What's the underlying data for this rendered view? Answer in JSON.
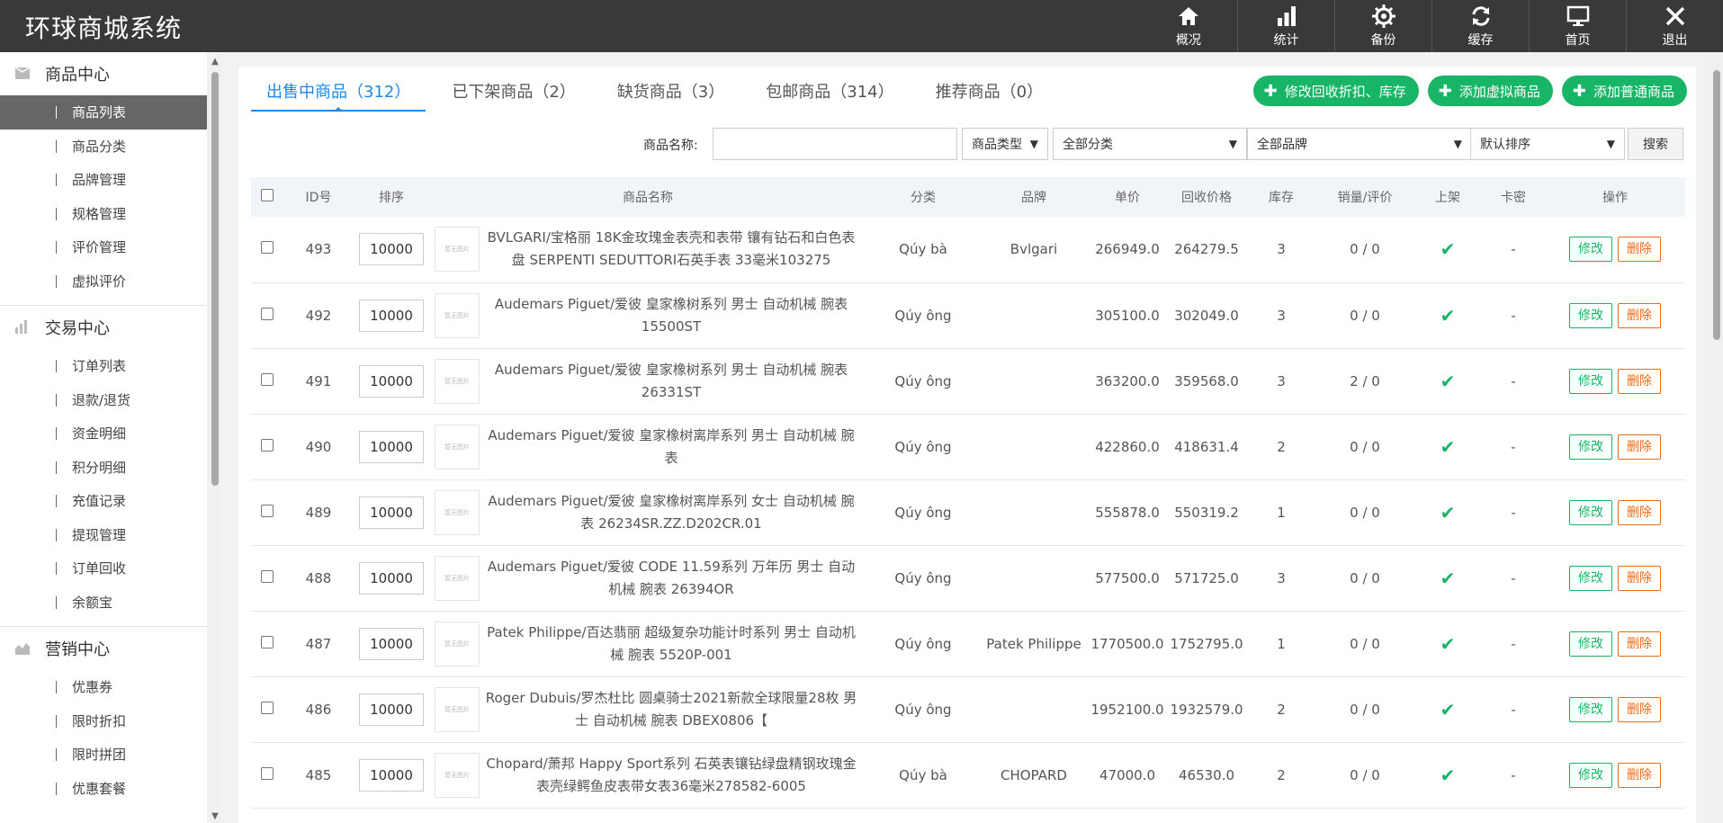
{
  "app": {
    "title": "环球商城系统"
  },
  "topnav": [
    {
      "label": "概况",
      "icon": "home-icon"
    },
    {
      "label": "统计",
      "icon": "bar-chart-icon"
    },
    {
      "label": "备份",
      "icon": "gear-icon"
    },
    {
      "label": "缓存",
      "icon": "refresh-icon"
    },
    {
      "label": "首页",
      "icon": "monitor-icon"
    },
    {
      "label": "退出",
      "icon": "close-icon"
    }
  ],
  "sidebar": {
    "groups": [
      {
        "title": "商品中心",
        "icon": "box-icon",
        "items": [
          "商品列表",
          "商品分类",
          "品牌管理",
          "规格管理",
          "评价管理",
          "虚拟评价"
        ]
      },
      {
        "title": "交易中心",
        "icon": "bars-icon",
        "items": [
          "订单列表",
          "退款/退货",
          "资金明细",
          "积分明细",
          "充值记录",
          "提现管理",
          "订单回收",
          "余额宝"
        ]
      },
      {
        "title": "营销中心",
        "icon": "area-chart-icon",
        "items": [
          "优惠券",
          "限时折扣",
          "限时拼团",
          "优惠套餐"
        ]
      }
    ],
    "active_item": "商品列表"
  },
  "tabs": [
    {
      "label": "出售中商品（312）",
      "active": true
    },
    {
      "label": "已下架商品（2）",
      "active": false
    },
    {
      "label": "缺货商品（3）",
      "active": false
    },
    {
      "label": "包邮商品（314）",
      "active": false
    },
    {
      "label": "推荐商品（0）",
      "active": false
    }
  ],
  "actions": {
    "modify_recycle": "修改回收折扣、库存",
    "add_virtual": "添加虚拟商品",
    "add_normal": "添加普通商品"
  },
  "search": {
    "name_label": "商品名称:",
    "name_value": "",
    "type_select": "商品类型",
    "category_select": "全部分类",
    "brand_select": "全部品牌",
    "sort_select": "默认排序",
    "search_button": "搜索"
  },
  "table": {
    "columns": [
      "ID号",
      "排序",
      "商品名称",
      "分类",
      "品牌",
      "单价",
      "回收价格",
      "库存",
      "销量/评价",
      "上架",
      "卡密",
      "操作"
    ],
    "thumb_text": "暂无图片",
    "edit_label": "修改",
    "delete_label": "删除",
    "check_mark": "✔",
    "rows": [
      {
        "id": "493",
        "sort": "10000",
        "name": "BVLGARI/宝格丽 18K金玫瑰金表壳和表带 镶有钻石和白色表盘 SERPENTI SEDUTTORI石英手表 33毫米103275",
        "category": "Qúy bà",
        "brand": "Bvlgari",
        "price": "266949.0",
        "recycle": "264279.5",
        "stock": "3",
        "sales": "0 / 0",
        "card": "-"
      },
      {
        "id": "492",
        "sort": "10000",
        "name": "Audemars Piguet/爱彼 皇家橡树系列 男士 自动机械 腕表 15500ST",
        "category": "Qúy ông",
        "brand": "",
        "price": "305100.0",
        "recycle": "302049.0",
        "stock": "3",
        "sales": "0 / 0",
        "card": "-"
      },
      {
        "id": "491",
        "sort": "10000",
        "name": "Audemars Piguet/爱彼 皇家橡树系列 男士 自动机械 腕表 26331ST",
        "category": "Qúy ông",
        "brand": "",
        "price": "363200.0",
        "recycle": "359568.0",
        "stock": "3",
        "sales": "2 / 0",
        "card": "-"
      },
      {
        "id": "490",
        "sort": "10000",
        "name": "Audemars Piguet/爱彼 皇家橡树离岸系列 男士 自动机械 腕表",
        "category": "Qúy ông",
        "brand": "",
        "price": "422860.0",
        "recycle": "418631.4",
        "stock": "2",
        "sales": "0 / 0",
        "card": "-"
      },
      {
        "id": "489",
        "sort": "10000",
        "name": "Audemars Piguet/爱彼 皇家橡树离岸系列 女士 自动机械 腕表 26234SR.ZZ.D202CR.01",
        "category": "Qúy ông",
        "brand": "",
        "price": "555878.0",
        "recycle": "550319.2",
        "stock": "1",
        "sales": "0 / 0",
        "card": "-"
      },
      {
        "id": "488",
        "sort": "10000",
        "name": "Audemars Piguet/爱彼 CODE 11.59系列 万年历 男士 自动机械 腕表 26394OR",
        "category": "Qúy ông",
        "brand": "",
        "price": "577500.0",
        "recycle": "571725.0",
        "stock": "3",
        "sales": "0 / 0",
        "card": "-"
      },
      {
        "id": "487",
        "sort": "10000",
        "name": "Patek Philippe/百达翡丽 超级复杂功能计时系列 男士 自动机械 腕表 5520P-001",
        "category": "Qúy ông",
        "brand": "Patek Philippe",
        "price": "1770500.0",
        "recycle": "1752795.0",
        "stock": "1",
        "sales": "0 / 0",
        "card": "-"
      },
      {
        "id": "486",
        "sort": "10000",
        "name": "Roger Dubuis/罗杰杜比 圆桌骑士2021新款全球限量28枚 男士 自动机械 腕表 DBEX0806【",
        "category": "Qúy ông",
        "brand": "",
        "price": "1952100.0",
        "recycle": "1932579.0",
        "stock": "2",
        "sales": "0 / 0",
        "card": "-"
      },
      {
        "id": "485",
        "sort": "10000",
        "name": "Chopard/萧邦 Happy Sport系列 石英表镶钻绿盘精钢玫瑰金表壳绿鳄鱼皮表带女表36毫米278582-6005",
        "category": "Qúy bà",
        "brand": "CHOPARD",
        "price": "47000.0",
        "recycle": "46530.0",
        "stock": "2",
        "sales": "0 / 0",
        "card": "-"
      }
    ]
  }
}
